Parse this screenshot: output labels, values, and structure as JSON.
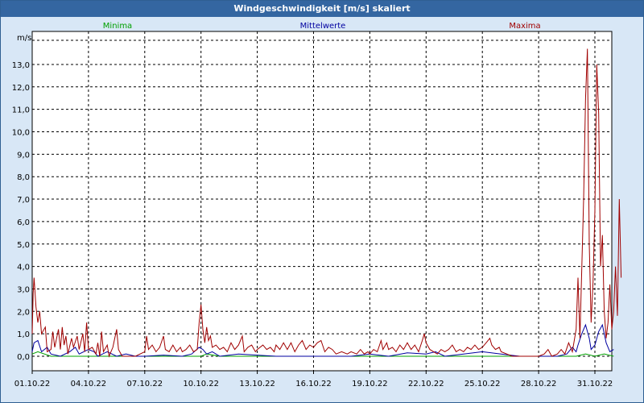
{
  "window": {
    "title": "Windgeschwindigkeit [m/s] skaliert"
  },
  "chart_data": {
    "type": "line",
    "title": "Windgeschwindigkeit [m/s] skaliert",
    "ylabel": "m/s",
    "ylim": [
      0,
      14
    ],
    "y_ticks": [
      "0,0",
      "1,0",
      "2,0",
      "3,0",
      "4,0",
      "5,0",
      "6,0",
      "7,0",
      "8,0",
      "9,0",
      "10,0",
      "11,0",
      "12,0",
      "13,0"
    ],
    "x_ticks": [
      "01.10.22",
      "04.10.22",
      "07.10.22",
      "10.10.22",
      "13.10.22",
      "16.10.22",
      "19.10.22",
      "22.10.22",
      "25.10.22",
      "28.10.22",
      "31.10.22"
    ],
    "x_range_days": [
      0,
      31
    ],
    "grid": true,
    "legend": [
      {
        "name": "Minima",
        "color": "#00a000"
      },
      {
        "name": "Mittelwerte",
        "color": "#0000a0"
      },
      {
        "name": "Maxima",
        "color": "#a00000"
      }
    ],
    "series": [
      {
        "name": "Minima",
        "color": "#00a000",
        "points": [
          [
            0,
            0.1
          ],
          [
            0.3,
            0.2
          ],
          [
            1,
            0
          ],
          [
            5,
            0
          ],
          [
            9,
            0
          ],
          [
            9.3,
            0.1
          ],
          [
            10,
            0
          ],
          [
            20,
            0
          ],
          [
            29,
            0
          ],
          [
            29.5,
            0.1
          ],
          [
            30,
            0
          ],
          [
            30.5,
            0.1
          ],
          [
            31,
            0
          ]
        ]
      },
      {
        "name": "Mittelwerte",
        "color": "#0000a0",
        "points": [
          [
            0,
            0.2
          ],
          [
            0.1,
            0.6
          ],
          [
            0.3,
            0.7
          ],
          [
            0.5,
            0.2
          ],
          [
            0.8,
            0.4
          ],
          [
            1,
            0.1
          ],
          [
            1.5,
            0
          ],
          [
            2,
            0.2
          ],
          [
            2.3,
            0.4
          ],
          [
            2.5,
            0.1
          ],
          [
            3,
            0.3
          ],
          [
            3.3,
            0.2
          ],
          [
            3.5,
            0
          ],
          [
            4,
            0.2
          ],
          [
            4.5,
            0
          ],
          [
            5,
            0.1
          ],
          [
            5.5,
            0
          ],
          [
            6,
            0
          ],
          [
            7,
            0.05
          ],
          [
            8,
            0
          ],
          [
            8.5,
            0.1
          ],
          [
            8.9,
            0.4
          ],
          [
            9.1,
            0.3
          ],
          [
            9.3,
            0.1
          ],
          [
            9.6,
            0.2
          ],
          [
            10,
            0
          ],
          [
            11,
            0.1
          ],
          [
            13,
            0
          ],
          [
            17,
            0
          ],
          [
            18,
            0.1
          ],
          [
            19,
            0
          ],
          [
            20,
            0.15
          ],
          [
            21,
            0.1
          ],
          [
            21.5,
            0.2
          ],
          [
            22,
            0
          ],
          [
            23,
            0.1
          ],
          [
            24,
            0.2
          ],
          [
            25,
            0.1
          ],
          [
            26,
            0
          ],
          [
            27,
            0
          ],
          [
            28,
            0
          ],
          [
            28.5,
            0.1
          ],
          [
            28.8,
            0.4
          ],
          [
            29,
            0.2
          ],
          [
            29.1,
            0.5
          ],
          [
            29.3,
            1.0
          ],
          [
            29.5,
            1.4
          ],
          [
            29.7,
            0.8
          ],
          [
            29.8,
            0.3
          ],
          [
            30,
            0.5
          ],
          [
            30.2,
            1.1
          ],
          [
            30.4,
            1.4
          ],
          [
            30.6,
            0.6
          ],
          [
            30.8,
            0.2
          ],
          [
            31,
            0.3
          ]
        ]
      },
      {
        "name": "Maxima",
        "color": "#a00000",
        "points": [
          [
            0,
            1.0
          ],
          [
            0.05,
            2.8
          ],
          [
            0.1,
            3.5
          ],
          [
            0.2,
            2.2
          ],
          [
            0.3,
            1.5
          ],
          [
            0.4,
            2.0
          ],
          [
            0.5,
            1.0
          ],
          [
            0.7,
            1.3
          ],
          [
            0.8,
            0.2
          ],
          [
            1,
            0.3
          ],
          [
            1.1,
            1.1
          ],
          [
            1.2,
            0.4
          ],
          [
            1.4,
            1.2
          ],
          [
            1.5,
            0.3
          ],
          [
            1.6,
            1.3
          ],
          [
            1.7,
            0.5
          ],
          [
            1.8,
            0.9
          ],
          [
            1.9,
            0.1
          ],
          [
            2.1,
            0.8
          ],
          [
            2.2,
            0.4
          ],
          [
            2.4,
            0.9
          ],
          [
            2.5,
            0.3
          ],
          [
            2.7,
            1.0
          ],
          [
            2.8,
            0.2
          ],
          [
            2.9,
            1.5
          ],
          [
            3.0,
            0.3
          ],
          [
            3.2,
            0.4
          ],
          [
            3.4,
            0.1
          ],
          [
            3.5,
            0.6
          ],
          [
            3.6,
            0
          ],
          [
            3.7,
            1.1
          ],
          [
            3.8,
            0.2
          ],
          [
            4.0,
            0.5
          ],
          [
            4.1,
            0
          ],
          [
            4.3,
            0.4
          ],
          [
            4.5,
            1.2
          ],
          [
            4.6,
            0.3
          ],
          [
            4.8,
            0
          ],
          [
            5.5,
            0
          ],
          [
            6.0,
            0.2
          ],
          [
            6.1,
            0.9
          ],
          [
            6.2,
            0.3
          ],
          [
            6.4,
            0.5
          ],
          [
            6.6,
            0.2
          ],
          [
            6.8,
            0.4
          ],
          [
            7.0,
            0.9
          ],
          [
            7.1,
            0.3
          ],
          [
            7.3,
            0.2
          ],
          [
            7.5,
            0.5
          ],
          [
            7.7,
            0.2
          ],
          [
            7.9,
            0.4
          ],
          [
            8.0,
            0.2
          ],
          [
            8.2,
            0.3
          ],
          [
            8.4,
            0.5
          ],
          [
            8.6,
            0.2
          ],
          [
            8.8,
            0.3
          ],
          [
            8.9,
            1.5
          ],
          [
            9.0,
            2.3
          ],
          [
            9.1,
            1.2
          ],
          [
            9.2,
            0.6
          ],
          [
            9.3,
            1.3
          ],
          [
            9.4,
            0.7
          ],
          [
            9.5,
            0.9
          ],
          [
            9.6,
            0.4
          ],
          [
            9.8,
            0.5
          ],
          [
            10.0,
            0.3
          ],
          [
            10.2,
            0.4
          ],
          [
            10.4,
            0.2
          ],
          [
            10.6,
            0.6
          ],
          [
            10.8,
            0.3
          ],
          [
            11.0,
            0.5
          ],
          [
            11.2,
            0.9
          ],
          [
            11.3,
            0.2
          ],
          [
            11.5,
            0.4
          ],
          [
            11.7,
            0.5
          ],
          [
            11.9,
            0.2
          ],
          [
            12.0,
            0.3
          ],
          [
            12.3,
            0.5
          ],
          [
            12.5,
            0.3
          ],
          [
            12.7,
            0.4
          ],
          [
            12.9,
            0.2
          ],
          [
            13.0,
            0.5
          ],
          [
            13.2,
            0.3
          ],
          [
            13.4,
            0.6
          ],
          [
            13.6,
            0.3
          ],
          [
            13.8,
            0.6
          ],
          [
            14.0,
            0.2
          ],
          [
            14.2,
            0.5
          ],
          [
            14.4,
            0.7
          ],
          [
            14.6,
            0.3
          ],
          [
            14.8,
            0.5
          ],
          [
            15.0,
            0.4
          ],
          [
            15.2,
            0.6
          ],
          [
            15.4,
            0.7
          ],
          [
            15.6,
            0.2
          ],
          [
            15.8,
            0.4
          ],
          [
            16.0,
            0.3
          ],
          [
            16.2,
            0.1
          ],
          [
            16.5,
            0.2
          ],
          [
            16.8,
            0.1
          ],
          [
            17.0,
            0.2
          ],
          [
            17.3,
            0.1
          ],
          [
            17.5,
            0.3
          ],
          [
            17.7,
            0.1
          ],
          [
            17.9,
            0.2
          ],
          [
            18.0,
            0.1
          ],
          [
            18.2,
            0.3
          ],
          [
            18.4,
            0.2
          ],
          [
            18.6,
            0.7
          ],
          [
            18.7,
            0.3
          ],
          [
            18.9,
            0.6
          ],
          [
            19.0,
            0.3
          ],
          [
            19.2,
            0.4
          ],
          [
            19.4,
            0.2
          ],
          [
            19.6,
            0.5
          ],
          [
            19.8,
            0.3
          ],
          [
            20.0,
            0.6
          ],
          [
            20.2,
            0.3
          ],
          [
            20.4,
            0.5
          ],
          [
            20.6,
            0.2
          ],
          [
            20.8,
            0.7
          ],
          [
            20.9,
            1.0
          ],
          [
            21.0,
            0.6
          ],
          [
            21.2,
            0.3
          ],
          [
            21.4,
            0.2
          ],
          [
            21.6,
            0.1
          ],
          [
            21.8,
            0.3
          ],
          [
            22.0,
            0.2
          ],
          [
            22.2,
            0.3
          ],
          [
            22.4,
            0.5
          ],
          [
            22.6,
            0.2
          ],
          [
            22.8,
            0.3
          ],
          [
            23.0,
            0.2
          ],
          [
            23.2,
            0.4
          ],
          [
            23.4,
            0.3
          ],
          [
            23.6,
            0.5
          ],
          [
            23.8,
            0.3
          ],
          [
            24.0,
            0.4
          ],
          [
            24.2,
            0.6
          ],
          [
            24.4,
            0.8
          ],
          [
            24.5,
            0.5
          ],
          [
            24.7,
            0.3
          ],
          [
            24.9,
            0.4
          ],
          [
            25.0,
            0.2
          ],
          [
            25.3,
            0.1
          ],
          [
            25.6,
            0
          ],
          [
            26,
            0
          ],
          [
            27,
            0
          ],
          [
            27.3,
            0.1
          ],
          [
            27.5,
            0.3
          ],
          [
            27.7,
            0
          ],
          [
            28,
            0.1
          ],
          [
            28.2,
            0.3
          ],
          [
            28.4,
            0.1
          ],
          [
            28.6,
            0.6
          ],
          [
            28.8,
            0.2
          ],
          [
            29.0,
            1.2
          ],
          [
            29.1,
            3.5
          ],
          [
            29.2,
            0.8
          ],
          [
            29.4,
            7.0
          ],
          [
            29.5,
            11.5
          ],
          [
            29.6,
            13.7
          ],
          [
            29.7,
            5.0
          ],
          [
            29.8,
            1.5
          ],
          [
            29.9,
            3.3
          ],
          [
            30.0,
            6.5
          ],
          [
            30.1,
            13.0
          ],
          [
            30.2,
            10.8
          ],
          [
            30.3,
            4.0
          ],
          [
            30.4,
            5.4
          ],
          [
            30.5,
            2.0
          ],
          [
            30.6,
            0.8
          ],
          [
            30.7,
            1.5
          ],
          [
            30.8,
            3.2
          ],
          [
            30.9,
            1.2
          ],
          [
            31.0,
            2.0
          ],
          [
            31.1,
            4.0
          ],
          [
            31.2,
            1.8
          ],
          [
            31.3,
            7.0
          ],
          [
            31.4,
            3.5
          ]
        ]
      }
    ]
  }
}
